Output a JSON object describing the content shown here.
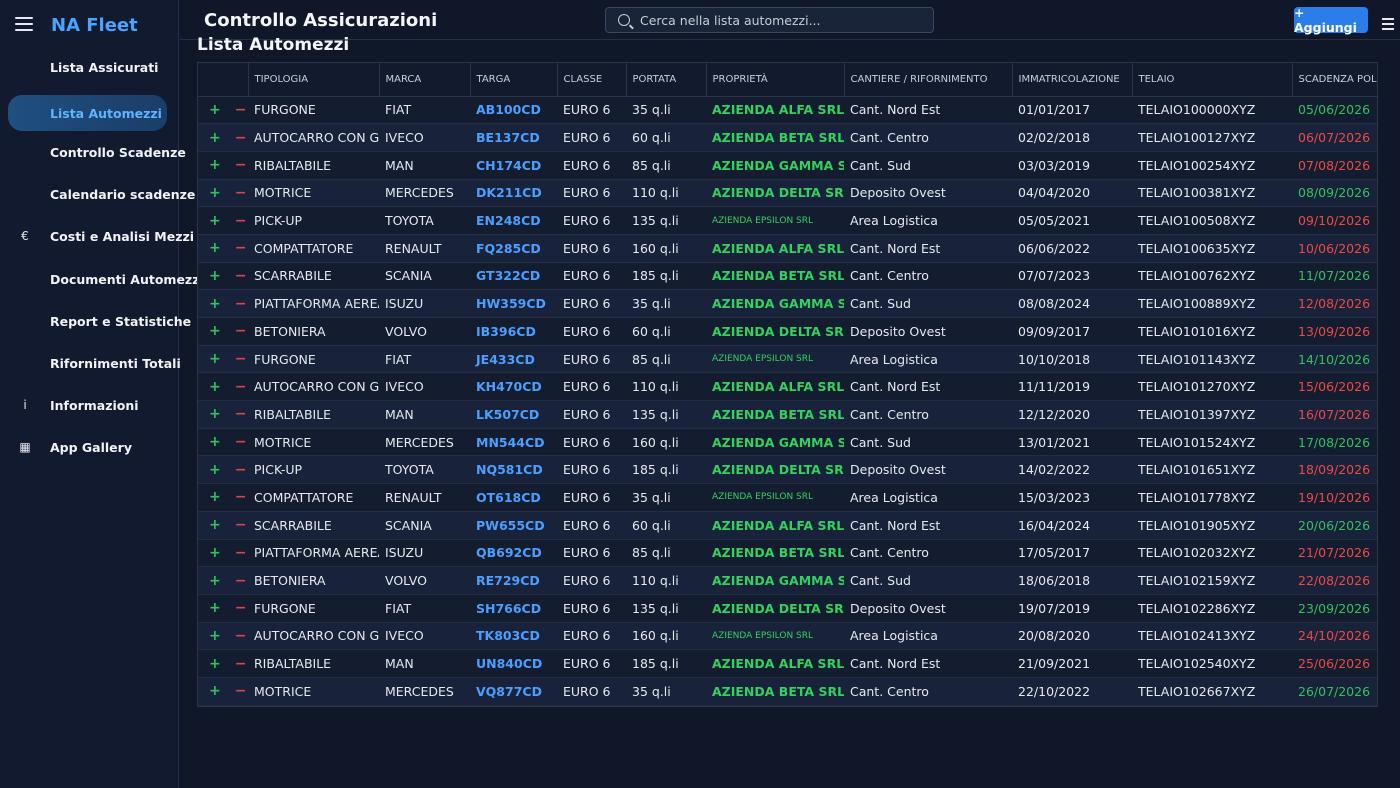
{
  "brand": "NA Fleet",
  "page_title": "Controllo Assicurazioni",
  "search": {
    "placeholder": "Cerca nella lista automezzi..."
  },
  "add_button": "+ Aggiungi",
  "section_title": "Lista Automezzi",
  "sidebar": {
    "items": [
      {
        "label": "Lista Assicurati",
        "icon": "shield-icon",
        "glyph": ""
      },
      {
        "label": "Lista Automezzi",
        "icon": "truck-icon",
        "glyph": "",
        "active": true
      },
      {
        "label": "Controllo Scadenze",
        "icon": "clock-icon",
        "glyph": ""
      },
      {
        "label": "Calendario scadenze",
        "icon": "calendar-icon",
        "glyph": ""
      },
      {
        "label": "Costi e Analisi Mezzi",
        "icon": "euro-icon",
        "glyph": "€"
      },
      {
        "label": "Documenti Automezzi",
        "icon": "document-icon",
        "glyph": ""
      },
      {
        "label": "Report e Statistiche",
        "icon": "chart-icon",
        "glyph": ""
      },
      {
        "label": "Rifornimenti Totali",
        "icon": "fuel-icon",
        "glyph": ""
      },
      {
        "label": "Informazioni",
        "icon": "info-icon",
        "glyph": "i"
      },
      {
        "label": "App Gallery",
        "icon": "grid-icon",
        "glyph": "▦"
      }
    ]
  },
  "table": {
    "columns": [
      "",
      "TIPOLOGIA",
      "MARCA",
      "TARGA",
      "CLASSE",
      "PORTATA",
      "PROPRIETÀ",
      "CANTIERE / RIFORNIMENTO",
      "IMMATRICOLAZIONE",
      "TELAIO",
      "SCADENZA POLIZZA"
    ],
    "plus_symbol": "+",
    "minus_symbol": "−",
    "rows": [
      {
        "tipologia": "FURGONE",
        "marca": "FIAT",
        "targa": "AB100CD",
        "classe": "EURO 6",
        "portata": "35 q.li",
        "proprieta": "AZIENDA ALFA SRL",
        "cantiere": "Cant. Nord Est",
        "immatricolazione": "01/01/2017",
        "telaio": "TELAIO100000XYZ",
        "scadenza": "05/06/2026",
        "status": "ok"
      },
      {
        "tipologia": "AUTOCARRO CON GRU",
        "marca": "IVECO",
        "targa": "BE137CD",
        "classe": "EURO 6",
        "portata": "60 q.li",
        "proprieta": "AZIENDA BETA SRL",
        "cantiere": "Cant. Centro",
        "immatricolazione": "02/02/2018",
        "telaio": "TELAIO100127XYZ",
        "scadenza": "06/07/2026",
        "status": "bad"
      },
      {
        "tipologia": "RIBALTABILE",
        "marca": "MAN",
        "targa": "CH174CD",
        "classe": "EURO 6",
        "portata": "85 q.li",
        "proprieta": "AZIENDA GAMMA SRL",
        "cantiere": "Cant. Sud",
        "immatricolazione": "03/03/2019",
        "telaio": "TELAIO100254XYZ",
        "scadenza": "07/08/2026",
        "status": "bad"
      },
      {
        "tipologia": "MOTRICE",
        "marca": "MERCEDES",
        "targa": "DK211CD",
        "classe": "EURO 6",
        "portata": "110 q.li",
        "proprieta": "AZIENDA DELTA SRL",
        "cantiere": "Deposito Ovest",
        "immatricolazione": "04/04/2020",
        "telaio": "TELAIO100381XYZ",
        "scadenza": "08/09/2026",
        "status": "ok"
      },
      {
        "tipologia": "PICK-UP",
        "marca": "TOYOTA",
        "targa": "EN248CD",
        "classe": "EURO 6",
        "portata": "135 q.li",
        "proprieta": "AZIENDA EPSILON SRL",
        "cantiere": "Area Logistica",
        "immatricolazione": "05/05/2021",
        "telaio": "TELAIO100508XYZ",
        "scadenza": "09/10/2026",
        "status": "bad",
        "small": true
      },
      {
        "tipologia": "COMPATTATORE",
        "marca": "RENAULT",
        "targa": "FQ285CD",
        "classe": "EURO 6",
        "portata": "160 q.li",
        "proprieta": "AZIENDA ALFA SRL",
        "cantiere": "Cant. Nord Est",
        "immatricolazione": "06/06/2022",
        "telaio": "TELAIO100635XYZ",
        "scadenza": "10/06/2026",
        "status": "bad"
      },
      {
        "tipologia": "SCARRABILE",
        "marca": "SCANIA",
        "targa": "GT322CD",
        "classe": "EURO 6",
        "portata": "185 q.li",
        "proprieta": "AZIENDA BETA SRL",
        "cantiere": "Cant. Centro",
        "immatricolazione": "07/07/2023",
        "telaio": "TELAIO100762XYZ",
        "scadenza": "11/07/2026",
        "status": "ok"
      },
      {
        "tipologia": "PIATTAFORMA AEREA",
        "marca": "ISUZU",
        "targa": "HW359CD",
        "classe": "EURO 6",
        "portata": "35 q.li",
        "proprieta": "AZIENDA GAMMA SRL",
        "cantiere": "Cant. Sud",
        "immatricolazione": "08/08/2024",
        "telaio": "TELAIO100889XYZ",
        "scadenza": "12/08/2026",
        "status": "bad"
      },
      {
        "tipologia": "BETONIERA",
        "marca": "VOLVO",
        "targa": "IB396CD",
        "classe": "EURO 6",
        "portata": "60 q.li",
        "proprieta": "AZIENDA DELTA SRL",
        "cantiere": "Deposito Ovest",
        "immatricolazione": "09/09/2017",
        "telaio": "TELAIO101016XYZ",
        "scadenza": "13/09/2026",
        "status": "bad"
      },
      {
        "tipologia": "FURGONE",
        "marca": "FIAT",
        "targa": "JE433CD",
        "classe": "EURO 6",
        "portata": "85 q.li",
        "proprieta": "AZIENDA EPSILON SRL",
        "cantiere": "Area Logistica",
        "immatricolazione": "10/10/2018",
        "telaio": "TELAIO101143XYZ",
        "scadenza": "14/10/2026",
        "status": "ok",
        "small": true
      },
      {
        "tipologia": "AUTOCARRO CON GRU",
        "marca": "IVECO",
        "targa": "KH470CD",
        "classe": "EURO 6",
        "portata": "110 q.li",
        "proprieta": "AZIENDA ALFA SRL",
        "cantiere": "Cant. Nord Est",
        "immatricolazione": "11/11/2019",
        "telaio": "TELAIO101270XYZ",
        "scadenza": "15/06/2026",
        "status": "bad"
      },
      {
        "tipologia": "RIBALTABILE",
        "marca": "MAN",
        "targa": "LK507CD",
        "classe": "EURO 6",
        "portata": "135 q.li",
        "proprieta": "AZIENDA BETA SRL",
        "cantiere": "Cant. Centro",
        "immatricolazione": "12/12/2020",
        "telaio": "TELAIO101397XYZ",
        "scadenza": "16/07/2026",
        "status": "bad"
      },
      {
        "tipologia": "MOTRICE",
        "marca": "MERCEDES",
        "targa": "MN544CD",
        "classe": "EURO 6",
        "portata": "160 q.li",
        "proprieta": "AZIENDA GAMMA SRL",
        "cantiere": "Cant. Sud",
        "immatricolazione": "13/01/2021",
        "telaio": "TELAIO101524XYZ",
        "scadenza": "17/08/2026",
        "status": "ok"
      },
      {
        "tipologia": "PICK-UP",
        "marca": "TOYOTA",
        "targa": "NQ581CD",
        "classe": "EURO 6",
        "portata": "185 q.li",
        "proprieta": "AZIENDA DELTA SRL",
        "cantiere": "Deposito Ovest",
        "immatricolazione": "14/02/2022",
        "telaio": "TELAIO101651XYZ",
        "scadenza": "18/09/2026",
        "status": "bad"
      },
      {
        "tipologia": "COMPATTATORE",
        "marca": "RENAULT",
        "targa": "OT618CD",
        "classe": "EURO 6",
        "portata": "35 q.li",
        "proprieta": "AZIENDA EPSILON SRL",
        "cantiere": "Area Logistica",
        "immatricolazione": "15/03/2023",
        "telaio": "TELAIO101778XYZ",
        "scadenza": "19/10/2026",
        "status": "bad",
        "small": true
      },
      {
        "tipologia": "SCARRABILE",
        "marca": "SCANIA",
        "targa": "PW655CD",
        "classe": "EURO 6",
        "portata": "60 q.li",
        "proprieta": "AZIENDA ALFA SRL",
        "cantiere": "Cant. Nord Est",
        "immatricolazione": "16/04/2024",
        "telaio": "TELAIO101905XYZ",
        "scadenza": "20/06/2026",
        "status": "ok"
      },
      {
        "tipologia": "PIATTAFORMA AEREA",
        "marca": "ISUZU",
        "targa": "QB692CD",
        "classe": "EURO 6",
        "portata": "85 q.li",
        "proprieta": "AZIENDA BETA SRL",
        "cantiere": "Cant. Centro",
        "immatricolazione": "17/05/2017",
        "telaio": "TELAIO102032XYZ",
        "scadenza": "21/07/2026",
        "status": "bad"
      },
      {
        "tipologia": "BETONIERA",
        "marca": "VOLVO",
        "targa": "RE729CD",
        "classe": "EURO 6",
        "portata": "110 q.li",
        "proprieta": "AZIENDA GAMMA SRL",
        "cantiere": "Cant. Sud",
        "immatricolazione": "18/06/2018",
        "telaio": "TELAIO102159XYZ",
        "scadenza": "22/08/2026",
        "status": "bad"
      },
      {
        "tipologia": "FURGONE",
        "marca": "FIAT",
        "targa": "SH766CD",
        "classe": "EURO 6",
        "portata": "135 q.li",
        "proprieta": "AZIENDA DELTA SRL",
        "cantiere": "Deposito Ovest",
        "immatricolazione": "19/07/2019",
        "telaio": "TELAIO102286XYZ",
        "scadenza": "23/09/2026",
        "status": "ok"
      },
      {
        "tipologia": "AUTOCARRO CON GRU",
        "marca": "IVECO",
        "targa": "TK803CD",
        "classe": "EURO 6",
        "portata": "160 q.li",
        "proprieta": "AZIENDA EPSILON SRL",
        "cantiere": "Area Logistica",
        "immatricolazione": "20/08/2020",
        "telaio": "TELAIO102413XYZ",
        "scadenza": "24/10/2026",
        "status": "bad",
        "small": true
      },
      {
        "tipologia": "RIBALTABILE",
        "marca": "MAN",
        "targa": "UN840CD",
        "classe": "EURO 6",
        "portata": "185 q.li",
        "proprieta": "AZIENDA ALFA SRL",
        "cantiere": "Cant. Nord Est",
        "immatricolazione": "21/09/2021",
        "telaio": "TELAIO102540XYZ",
        "scadenza": "25/06/2026",
        "status": "bad"
      },
      {
        "tipologia": "MOTRICE",
        "marca": "MERCEDES",
        "targa": "VQ877CD",
        "classe": "EURO 6",
        "portata": "35 q.li",
        "proprieta": "AZIENDA BETA SRL",
        "cantiere": "Cant. Centro",
        "immatricolazione": "22/10/2022",
        "telaio": "TELAIO102667XYZ",
        "scadenza": "26/07/2026",
        "status": "ok"
      }
    ]
  }
}
